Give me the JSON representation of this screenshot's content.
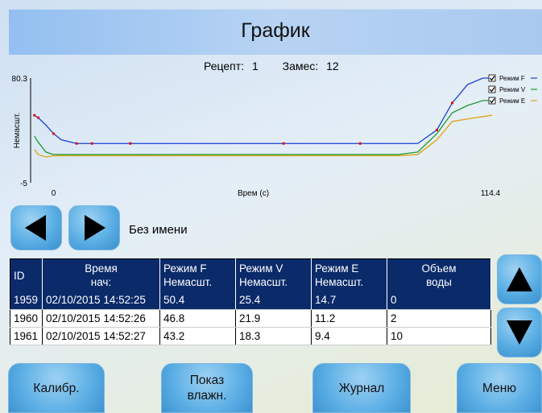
{
  "header": {
    "title": "График"
  },
  "recipe": {
    "recipe_label": "Рецепт:",
    "recipe_value": "1",
    "batch_label": "Замес:",
    "batch_value": "12"
  },
  "chart_data": {
    "type": "line",
    "title": "",
    "xlabel": "Врем (с)",
    "ylabel": "Немасшт.",
    "xlim": [
      0,
      114.4
    ],
    "ylim": [
      -5,
      80.3
    ],
    "ytick_labels": [
      "80.3",
      "-5"
    ],
    "xtick_labels": [
      "0",
      "114.4"
    ],
    "legend_position": "top-right",
    "series": [
      {
        "name": "Режим F",
        "color": "#1a3fd0",
        "checked": true,
        "x": [
          -5,
          -4,
          -2,
          0,
          2,
          6,
          10,
          14,
          20,
          40,
          60,
          80,
          95,
          100,
          104,
          108,
          112,
          114.4
        ],
        "y": [
          50,
          48,
          42,
          35,
          30,
          27,
          27,
          27,
          27,
          27,
          27,
          27,
          27,
          38,
          60,
          75,
          80.3,
          80.3
        ]
      },
      {
        "name": "Режим V",
        "color": "#1e9a2c",
        "checked": true,
        "x": [
          -5,
          -4,
          -2,
          0,
          2,
          6,
          10,
          30,
          60,
          90,
          95,
          100,
          104,
          108,
          112,
          114.4
        ],
        "y": [
          33,
          28,
          20,
          18,
          18,
          18,
          18,
          18,
          18,
          18,
          20,
          35,
          52,
          58,
          62,
          62
        ]
      },
      {
        "name": "Режим E",
        "color": "#e0a010",
        "checked": true,
        "x": [
          -5,
          -4,
          -2,
          0,
          6,
          10,
          30,
          60,
          90,
          95,
          100,
          104,
          110,
          114.4
        ],
        "y": [
          22,
          18,
          16,
          17,
          17,
          17,
          17,
          17,
          17,
          18,
          30,
          45,
          48,
          50
        ]
      }
    ]
  },
  "nav": {
    "record_name": "Без имени"
  },
  "table": {
    "headers": [
      "ID",
      "Время\nнач:",
      "Режим F\nНемасшт.",
      "Режим V\nНемасшт.",
      "Режим E\nНемасшт.",
      "Объем\nводы"
    ],
    "rows": [
      {
        "id": "1959",
        "time": "02/10/2015 14:52:25",
        "f": "50.4",
        "v": "25.4",
        "e": "14.7",
        "water": "0"
      },
      {
        "id": "1960",
        "time": "02/10/2015 14:52:26",
        "f": "46.8",
        "v": "21.9",
        "e": "11.2",
        "water": "2"
      },
      {
        "id": "1961",
        "time": "02/10/2015 14:52:27",
        "f": "43.2",
        "v": "18.3",
        "e": "9.4",
        "water": "10"
      }
    ]
  },
  "buttons": {
    "calib": "Калибр.",
    "moisture": "Показ\nвлажн.",
    "journal": "Журнал",
    "menu": "Меню"
  }
}
